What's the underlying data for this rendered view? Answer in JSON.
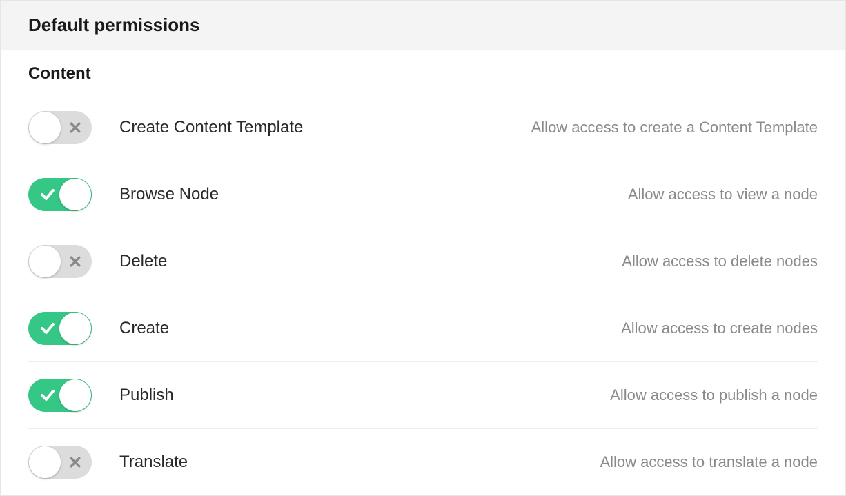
{
  "header": {
    "title": "Default permissions"
  },
  "section": {
    "title": "Content"
  },
  "permissions": [
    {
      "enabled": false,
      "label": "Create Content Template",
      "description": "Allow access to create a Content Template"
    },
    {
      "enabled": true,
      "label": "Browse Node",
      "description": "Allow access to view a node"
    },
    {
      "enabled": false,
      "label": "Delete",
      "description": "Allow access to delete nodes"
    },
    {
      "enabled": true,
      "label": "Create",
      "description": "Allow access to create nodes"
    },
    {
      "enabled": true,
      "label": "Publish",
      "description": "Allow access to publish a node"
    },
    {
      "enabled": false,
      "label": "Translate",
      "description": "Allow access to translate a node"
    }
  ],
  "colors": {
    "toggle_on": "#35c786",
    "toggle_off": "#dcdcdc",
    "text_muted": "#8a8a8a"
  }
}
